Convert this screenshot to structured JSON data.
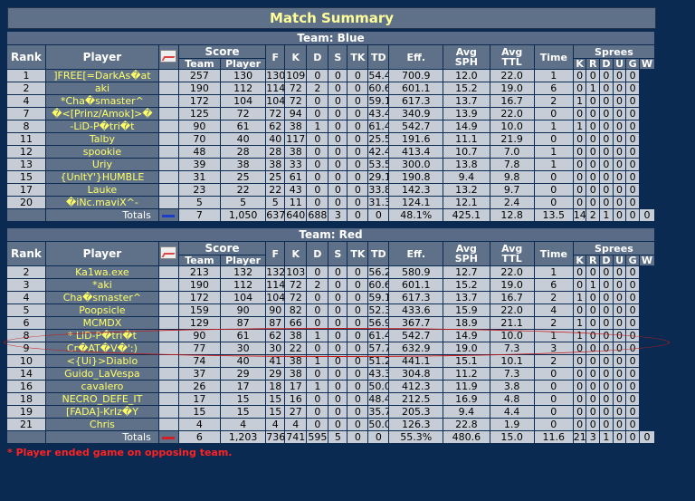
{
  "title": "Match Summary",
  "columns": {
    "rank": "Rank",
    "player": "Player",
    "score": "Score",
    "team": "Team",
    "player_score": "Player",
    "f": "F",
    "k": "K",
    "d": "D",
    "s": "S",
    "tk": "TK",
    "td": "TD",
    "eff": "Eff.",
    "avg_sph_1": "Avg",
    "avg_sph_2": "SPH",
    "avg_ttl_1": "Avg",
    "avg_ttl_2": "TTL",
    "time": "Time",
    "sprees": "Sprees",
    "sk": "K",
    "sr": "R",
    "sd": "D",
    "su": "U",
    "sg": "G",
    "sw": "W"
  },
  "team_blue": {
    "label": "Team: Blue",
    "color": "#1a3cc8",
    "rows": [
      [
        "1",
        "]FREE[=DarkAs�at",
        "",
        "257",
        "130",
        "130",
        "109",
        "0",
        "0",
        "0",
        "54.4%",
        "700.9",
        "12.0",
        "22.0",
        "1",
        "0",
        "0",
        "0",
        "0",
        "0"
      ],
      [
        "2",
        "aki",
        "",
        "190",
        "112",
        "114",
        "72",
        "2",
        "0",
        "0",
        "60.6%",
        "601.1",
        "15.2",
        "19.0",
        "6",
        "0",
        "1",
        "0",
        "0",
        "0"
      ],
      [
        "4",
        "*Cha�smaster^",
        "",
        "172",
        "104",
        "104",
        "72",
        "0",
        "0",
        "0",
        "59.1%",
        "617.3",
        "13.7",
        "16.7",
        "2",
        "1",
        "0",
        "0",
        "0",
        "0"
      ],
      [
        "7",
        "�<[Prinz/Amok]>�",
        "",
        "125",
        "72",
        "72",
        "94",
        "0",
        "0",
        "0",
        "43.4%",
        "340.9",
        "13.9",
        "22.0",
        "0",
        "0",
        "0",
        "0",
        "0",
        "0"
      ],
      [
        "8",
        "-LiD-P�tri�t",
        "",
        "90",
        "61",
        "62",
        "38",
        "1",
        "0",
        "0",
        "61.4%",
        "542.7",
        "14.9",
        "10.0",
        "1",
        "1",
        "0",
        "0",
        "0",
        "0"
      ],
      [
        "11",
        "Talby",
        "",
        "70",
        "40",
        "40",
        "117",
        "0",
        "0",
        "0",
        "25.5%",
        "191.6",
        "11.1",
        "21.9",
        "0",
        "0",
        "0",
        "0",
        "0",
        "0"
      ],
      [
        "12",
        "spookie",
        "",
        "48",
        "28",
        "28",
        "38",
        "0",
        "0",
        "0",
        "42.4%",
        "413.4",
        "10.7",
        "7.0",
        "1",
        "0",
        "0",
        "0",
        "0",
        "0"
      ],
      [
        "13",
        "Uriy",
        "",
        "39",
        "38",
        "38",
        "33",
        "0",
        "0",
        "0",
        "53.5%",
        "300.0",
        "13.8",
        "7.8",
        "1",
        "0",
        "0",
        "0",
        "0",
        "0"
      ],
      [
        "15",
        "{UnItY'}HUMBLE",
        "",
        "31",
        "25",
        "25",
        "61",
        "0",
        "0",
        "0",
        "29.1%",
        "190.8",
        "9.4",
        "9.8",
        "0",
        "0",
        "0",
        "0",
        "0",
        "0"
      ],
      [
        "17",
        "Lauke",
        "",
        "23",
        "22",
        "22",
        "43",
        "0",
        "0",
        "0",
        "33.8%",
        "142.3",
        "13.2",
        "9.7",
        "0",
        "0",
        "0",
        "0",
        "0",
        "0"
      ],
      [
        "20",
        "�iNc.maviX^-",
        "",
        "5",
        "5",
        "5",
        "11",
        "0",
        "0",
        "0",
        "31.3%",
        "124.1",
        "12.1",
        "2.4",
        "0",
        "0",
        "0",
        "0",
        "0",
        "0"
      ]
    ],
    "totals": [
      "Totals",
      "7",
      "1,050",
      "637",
      "640",
      "688",
      "3",
      "0",
      "0",
      "48.1%",
      "425.1",
      "12.8",
      "13.5",
      "14",
      "2",
      "1",
      "0",
      "0",
      "0"
    ]
  },
  "team_red": {
    "label": "Team: Red",
    "color": "#d42020",
    "rows": [
      [
        "2",
        "Ka1wa.exe",
        "",
        "213",
        "132",
        "132",
        "103",
        "0",
        "0",
        "0",
        "56.2%",
        "580.9",
        "12.7",
        "22.0",
        "1",
        "0",
        "0",
        "0",
        "0",
        "0"
      ],
      [
        "3",
        "*aki",
        "",
        "190",
        "112",
        "114",
        "72",
        "2",
        "0",
        "0",
        "60.6%",
        "601.1",
        "15.2",
        "19.0",
        "6",
        "0",
        "1",
        "0",
        "0",
        "0"
      ],
      [
        "4",
        "Cha�smaster^",
        "",
        "172",
        "104",
        "104",
        "72",
        "0",
        "0",
        "0",
        "59.1%",
        "617.3",
        "13.7",
        "16.7",
        "2",
        "1",
        "0",
        "0",
        "0",
        "0"
      ],
      [
        "5",
        "Poopsicle",
        "",
        "159",
        "90",
        "90",
        "82",
        "0",
        "0",
        "0",
        "52.3%",
        "433.6",
        "15.9",
        "22.0",
        "4",
        "0",
        "0",
        "0",
        "0",
        "0"
      ],
      [
        "6",
        "MCMDX",
        "",
        "129",
        "87",
        "87",
        "66",
        "0",
        "0",
        "0",
        "56.9%",
        "367.7",
        "18.9",
        "21.1",
        "2",
        "1",
        "0",
        "0",
        "0",
        "0"
      ],
      [
        "8",
        "* LiD-P�tri�t",
        "",
        "90",
        "61",
        "62",
        "38",
        "1",
        "0",
        "0",
        "61.4%",
        "542.7",
        "14.9",
        "10.0",
        "1",
        "1",
        "0",
        "0",
        "0",
        "0"
      ],
      [
        "9",
        "Cr�AT�V�':)",
        "",
        "77",
        "30",
        "30",
        "22",
        "0",
        "0",
        "0",
        "57.7%",
        "632.9",
        "19.0",
        "7.3",
        "3",
        "0",
        "0",
        "0",
        "0",
        "0"
      ],
      [
        "10",
        "<{Ui}>Diablo",
        "",
        "74",
        "40",
        "41",
        "38",
        "1",
        "0",
        "0",
        "51.2%",
        "441.1",
        "15.1",
        "10.1",
        "2",
        "0",
        "0",
        "0",
        "0",
        "0"
      ],
      [
        "14",
        "Guido_LaVespa",
        "",
        "37",
        "29",
        "29",
        "38",
        "0",
        "0",
        "0",
        "43.3%",
        "304.8",
        "11.2",
        "7.3",
        "0",
        "0",
        "0",
        "0",
        "0",
        "0"
      ],
      [
        "16",
        "cavalero",
        "",
        "26",
        "17",
        "18",
        "17",
        "1",
        "0",
        "0",
        "50.0%",
        "412.3",
        "11.9",
        "3.8",
        "0",
        "0",
        "0",
        "0",
        "0",
        "0"
      ],
      [
        "18",
        "NECRO_DEFE_IT",
        "",
        "17",
        "15",
        "15",
        "16",
        "0",
        "0",
        "0",
        "48.4%",
        "212.5",
        "16.9",
        "4.8",
        "0",
        "0",
        "0",
        "0",
        "0",
        "0"
      ],
      [
        "19",
        "[FADA]-KrIz�Y",
        "",
        "15",
        "15",
        "15",
        "27",
        "0",
        "0",
        "0",
        "35.7%",
        "205.3",
        "9.4",
        "4.4",
        "0",
        "0",
        "0",
        "0",
        "0",
        "0"
      ],
      [
        "21",
        "Chris",
        "",
        "4",
        "4",
        "4",
        "4",
        "0",
        "0",
        "0",
        "50.0%",
        "126.3",
        "22.8",
        "1.9",
        "0",
        "0",
        "0",
        "0",
        "0",
        "0"
      ]
    ],
    "totals": [
      "Totals",
      "6",
      "1,203",
      "736",
      "741",
      "595",
      "5",
      "0",
      "0",
      "55.3%",
      "480.6",
      "15.0",
      "11.6",
      "21",
      "3",
      "1",
      "0",
      "0",
      "0"
    ]
  },
  "footnote": "* Player ended game on opposing team.",
  "highlight_color": "#c41a1a"
}
